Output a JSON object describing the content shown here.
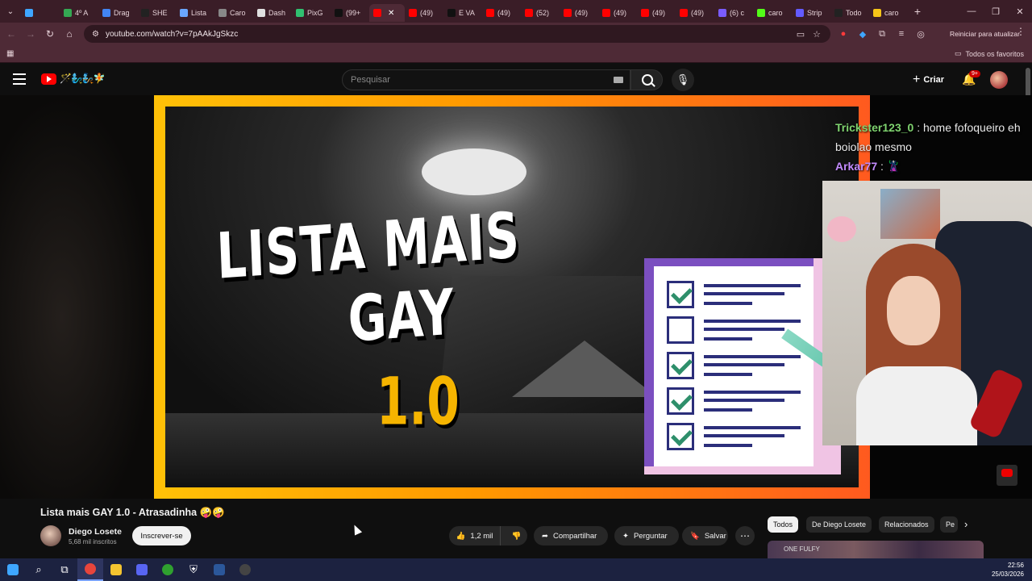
{
  "browser": {
    "tabs": [
      {
        "label": "",
        "color": "#3ea6ff"
      },
      {
        "label": "4º A",
        "color": "#34a853"
      },
      {
        "label": "Drag",
        "color": "#4285f4"
      },
      {
        "label": "SHE",
        "color": "#222222"
      },
      {
        "label": "Lista",
        "color": "#6aa7ff"
      },
      {
        "label": "Caro",
        "color": "#888888"
      },
      {
        "label": "Dash",
        "color": "#e0e0e0"
      },
      {
        "label": "PixG",
        "color": "#30c070"
      },
      {
        "label": "(99+",
        "color": "#111111"
      },
      {
        "label": "",
        "color": "#ff0000",
        "active": true
      },
      {
        "label": "(49)",
        "color": "#ff0000"
      },
      {
        "label": "E VA",
        "color": "#111111"
      },
      {
        "label": "(49)",
        "color": "#ff0000"
      },
      {
        "label": "(52)",
        "color": "#ff0000"
      },
      {
        "label": "(49)",
        "color": "#ff0000"
      },
      {
        "label": "(49)",
        "color": "#ff0000"
      },
      {
        "label": "(49)",
        "color": "#ff0000"
      },
      {
        "label": "(49)",
        "color": "#ff0000"
      },
      {
        "label": "(6) c",
        "color": "#7a5cff"
      },
      {
        "label": "caro",
        "color": "#53fc18"
      },
      {
        "label": "Strip",
        "color": "#635bff"
      },
      {
        "label": "Todo",
        "color": "#222222"
      },
      {
        "label": "caro",
        "color": "#f5c518"
      }
    ],
    "url": "youtube.com/watch?v=7pAAkJgSkzc",
    "restart_label": "Reiniciar para atualizar",
    "all_favorites": "Todos os favoritos"
  },
  "youtube": {
    "logo_emoji": "🪄🧞‍♂️🧞🧚",
    "search_placeholder": "Pesquisar",
    "create_label": "Criar",
    "notif_badge": "9+"
  },
  "thumbnail": {
    "title_line1": "LISTA MAIS",
    "title_line2": "GAY",
    "version": "1.0"
  },
  "chat": {
    "msg1_user": "Trickster123_0",
    "msg1_text": " : home fofoqueiro eh boiolao mesmo",
    "msg2_user": "Arkar77",
    "msg2_text": " : 🦹"
  },
  "video": {
    "title": "Lista mais GAY 1.0 - Atrasadinha 🤪🤪",
    "channel": "Diego Losete",
    "subscribers": "5,68 mil inscritos",
    "subscribe_label": "Inscrever-se",
    "likes": "1,2 mil",
    "share_label": "Compartilhar",
    "ask_label": "Perguntar",
    "save_label": "Salvar"
  },
  "chips": {
    "all": "Todos",
    "from_channel": "De Diego Losete",
    "related": "Relacionados",
    "partial": "Pe"
  },
  "reco": {
    "overlay_text": "ONE FULFY"
  },
  "taskbar": {
    "time": "22:56",
    "date": "25/03/2026"
  }
}
